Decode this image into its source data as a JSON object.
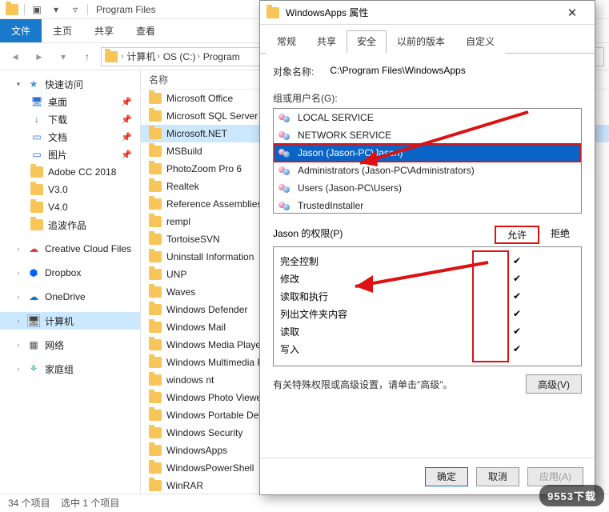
{
  "explorer": {
    "title": "Program Files",
    "ribbon": {
      "file": "文件",
      "home": "主页",
      "share": "共享",
      "view": "查看"
    },
    "breadcrumbs": [
      "计算机",
      "OS (C:)",
      "Program"
    ],
    "nav": {
      "quick": {
        "label": "快速访问",
        "items": [
          {
            "label": "桌面",
            "icon": "monitor",
            "pin": true
          },
          {
            "label": "下载",
            "icon": "download",
            "pin": true
          },
          {
            "label": "文档",
            "icon": "doc",
            "pin": true
          },
          {
            "label": "图片",
            "icon": "pic",
            "pin": true
          },
          {
            "label": "Adobe CC 2018",
            "icon": "folder"
          },
          {
            "label": "V3.0",
            "icon": "folder"
          },
          {
            "label": "V4.0",
            "icon": "folder"
          },
          {
            "label": "追波作品",
            "icon": "folder"
          }
        ]
      },
      "roots": [
        {
          "label": "Creative Cloud Files",
          "icon": "cloud-red"
        },
        {
          "label": "Dropbox",
          "icon": "dropbox"
        },
        {
          "label": "OneDrive",
          "icon": "onedrive"
        },
        {
          "label": "计算机",
          "icon": "computer",
          "selected": true
        },
        {
          "label": "网络",
          "icon": "network"
        },
        {
          "label": "家庭组",
          "icon": "homegroup"
        }
      ]
    },
    "list": {
      "header": "名称",
      "items": [
        "Microsoft Office",
        "Microsoft SQL Server",
        "Microsoft.NET",
        "MSBuild",
        "PhotoZoom Pro 6",
        "Realtek",
        "Reference Assemblies",
        "rempl",
        "TortoiseSVN",
        "Uninstall Information",
        "UNP",
        "Waves",
        "Windows Defender",
        "Windows Mail",
        "Windows Media Player",
        "Windows Multimedia Platform",
        "windows nt",
        "Windows Photo Viewer",
        "Windows Portable Devices",
        "Windows Security",
        "WindowsApps",
        "WindowsPowerShell",
        "WinRAR"
      ],
      "selected_index": 2
    },
    "status": {
      "count": "34 个项目",
      "selected": "选中 1 个项目"
    }
  },
  "dialog": {
    "title": "WindowsApps 属性",
    "tabs": [
      "常规",
      "共享",
      "安全",
      "以前的版本",
      "自定义"
    ],
    "active_tab": 2,
    "object_label": "对象名称:",
    "object_value": "C:\\Program Files\\WindowsApps",
    "group_label": "组或用户名(G):",
    "users": [
      {
        "name": "LOCAL SERVICE"
      },
      {
        "name": "NETWORK SERVICE"
      },
      {
        "name": "Jason (Jason-PC\\Jason)",
        "selected": true
      },
      {
        "name": "Administrators (Jason-PC\\Administrators)"
      },
      {
        "name": "Users (Jason-PC\\Users)"
      },
      {
        "name": "TrustedInstaller"
      }
    ],
    "perm_for": "Jason 的权限(P)",
    "col_allow": "允许",
    "col_deny": "拒绝",
    "perms": [
      {
        "name": "完全控制",
        "allow": true
      },
      {
        "name": "修改",
        "allow": true
      },
      {
        "name": "读取和执行",
        "allow": true
      },
      {
        "name": "列出文件夹内容",
        "allow": true
      },
      {
        "name": "读取",
        "allow": true
      },
      {
        "name": "写入",
        "allow": true
      }
    ],
    "adv_text": "有关特殊权限或高级设置，请单击\"高级\"。",
    "adv_btn": "高级(V)",
    "ok": "确定",
    "cancel": "取消",
    "apply": "应用(A)"
  },
  "watermark": "9553下载"
}
